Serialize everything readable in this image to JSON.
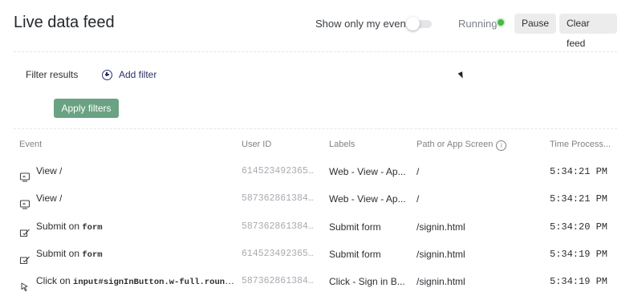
{
  "header": {
    "title": "Live data feed",
    "toggle_label": "Show only my events",
    "toggle_on": false,
    "status": "Running",
    "status_color": "#4ab54a",
    "pause_label": "Pause",
    "clear_label": "Clear feed"
  },
  "filters": {
    "label": "Filter results",
    "add_label": "Add filter",
    "apply_label": "Apply filters",
    "apply_color": "#6aa283"
  },
  "table": {
    "columns": [
      "Event",
      "User ID",
      "Labels",
      "Path or App Screen",
      "Time Process..."
    ],
    "rows": [
      {
        "icon": "screen-view-icon",
        "event_prefix": "View /",
        "event_code": "",
        "user_id": "614523492365...",
        "labels": "Web - View - Ap...",
        "path": "/",
        "time": "5:34:21 PM"
      },
      {
        "icon": "screen-view-icon",
        "event_prefix": "View /",
        "event_code": "",
        "user_id": "587362861384...",
        "labels": "Web - View - Ap...",
        "path": "/",
        "time": "5:34:21 PM"
      },
      {
        "icon": "form-submit-icon",
        "event_prefix": "Submit on",
        "event_code": "form",
        "user_id": "587362861384...",
        "labels": "Submit form",
        "path": "/signin.html",
        "time": "5:34:20 PM"
      },
      {
        "icon": "form-submit-icon",
        "event_prefix": "Submit on",
        "event_code": "form",
        "user_id": "614523492365...",
        "labels": "Submit form",
        "path": "/signin.html",
        "time": "5:34:19 PM"
      },
      {
        "icon": "click-icon",
        "event_prefix": "Click on",
        "event_code": "input#signInButton.w-full.round...",
        "user_id": "587362861384...",
        "labels": "Click - Sign in B...",
        "path": "/signin.html",
        "time": "5:34:19 PM"
      }
    ]
  }
}
